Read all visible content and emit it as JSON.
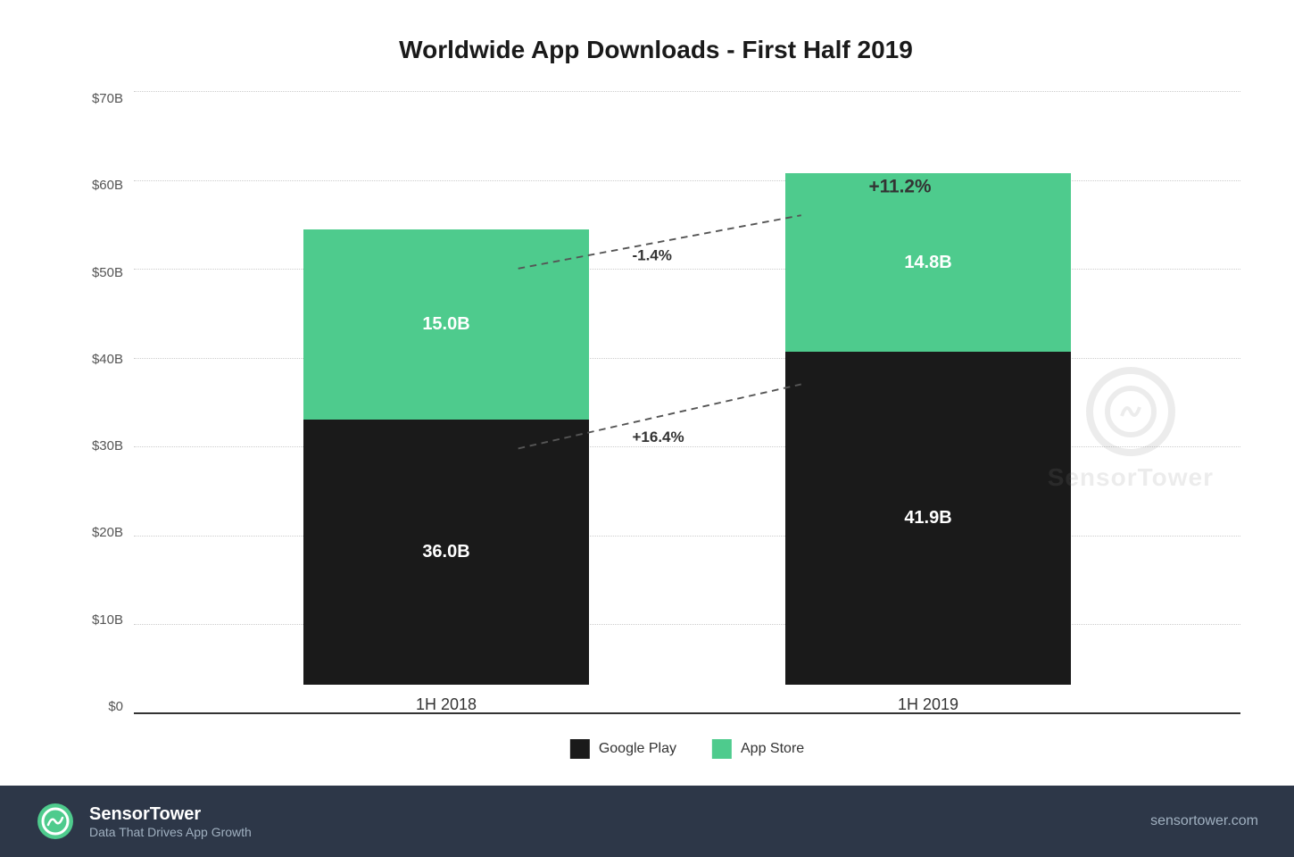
{
  "title": "Worldwide App Downloads - First Half 2019",
  "yAxis": {
    "labels": [
      "$0",
      "$10B",
      "$20B",
      "$30B",
      "$40B",
      "$50B",
      "$60B",
      "$70B"
    ]
  },
  "bars": [
    {
      "period": "1H 2018",
      "googlePlay": {
        "value": 36.0,
        "label": "36.0B",
        "heightPct": 51.4
      },
      "appStore": {
        "value": 15.0,
        "label": "15.0B",
        "heightPct": 21.4
      }
    },
    {
      "period": "1H 2019",
      "googlePlay": {
        "value": 41.9,
        "label": "41.9B",
        "heightPct": 59.9
      },
      "appStore": {
        "value": 14.8,
        "label": "14.8B",
        "heightPct": 21.1
      }
    }
  ],
  "annotations": {
    "total_growth": "+11.2%",
    "google_play_growth": "+16.4%",
    "app_store_change": "-1.4%"
  },
  "legend": {
    "googlePlay": {
      "label": "Google Play",
      "color": "#1a1a1a"
    },
    "appStore": {
      "label": "App Store",
      "color": "#4ecb8d"
    }
  },
  "footer": {
    "brand": "SensorTower",
    "tagline": "Data That Drives App Growth",
    "url": "sensortower.com"
  },
  "watermark": {
    "brand": "SensorTower"
  }
}
